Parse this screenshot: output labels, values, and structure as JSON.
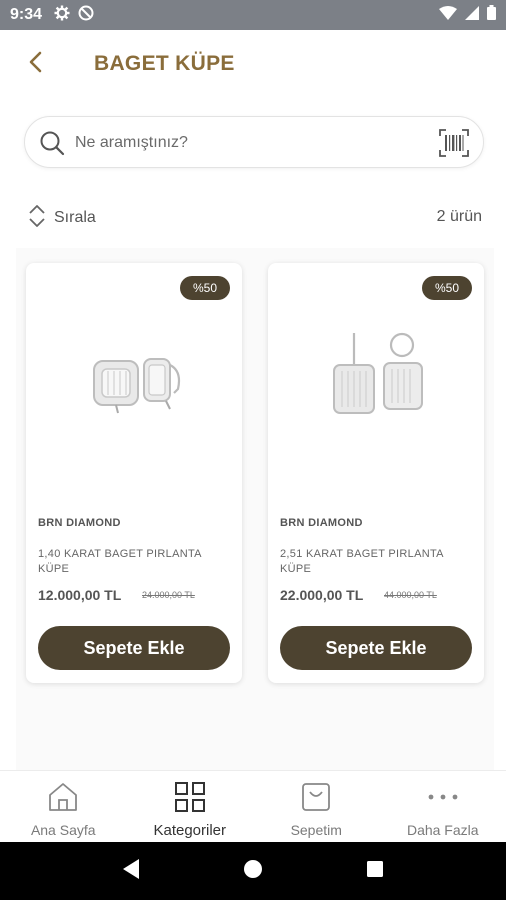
{
  "status_bar": {
    "time": "9:34"
  },
  "header": {
    "title": "BAGET KÜPE",
    "back_icon": "chevron-left-icon"
  },
  "search": {
    "placeholder": "Ne aramıştınız?",
    "value": ""
  },
  "toolbar": {
    "sort_label": "Sırala",
    "count": "2 ürün"
  },
  "products": [
    {
      "badge": "%50",
      "brand": "BRN DIAMOND",
      "name": "1,40 KARAT BAGET PIRLANTA KÜPE",
      "price": "12.000,00 TL",
      "old_price": "24.000,00 TL",
      "button": "Sepete Ekle"
    },
    {
      "badge": "%50",
      "brand": "BRN DIAMOND",
      "name": "2,51 KARAT BAGET PIRLANTA KÜPE",
      "price": "22.000,00 TL",
      "old_price": "44.000,00 TL",
      "button": "Sepete Ekle"
    }
  ],
  "tabbar": {
    "items": [
      {
        "label": "Ana Sayfa",
        "icon": "home-icon"
      },
      {
        "label": "Kategoriler",
        "icon": "grid-icon",
        "active": true
      },
      {
        "label": "Sepetim",
        "icon": "shopping-bag-icon"
      },
      {
        "label": "Daha Fazla",
        "icon": "more-icon"
      }
    ]
  },
  "colors": {
    "accent": "#8a6d3b",
    "button": "#4d4330",
    "status_bar": "#7c8087"
  }
}
